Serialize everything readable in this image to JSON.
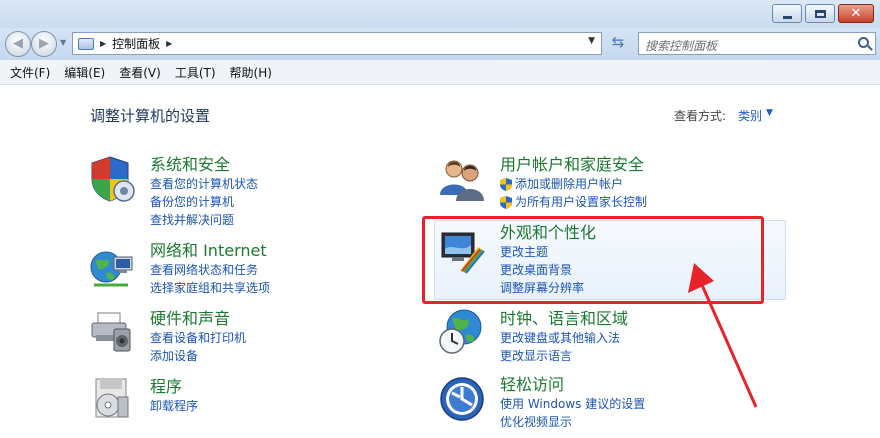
{
  "addressbar": {
    "breadcrumb": "控制面板",
    "search_placeholder": "搜索控制面板"
  },
  "menubar": {
    "items": [
      "文件(F)",
      "编辑(E)",
      "查看(V)",
      "工具(T)",
      "帮助(H)"
    ]
  },
  "main": {
    "title": "调整计算机的设置",
    "view_by_label": "查看方式:",
    "view_by_value": "类别",
    "categories": [
      {
        "title": "系统和安全",
        "links": [
          "查看您的计算机状态",
          "备份您的计算机",
          "查找并解决问题"
        ]
      },
      {
        "title": "网络和 Internet",
        "links": [
          "查看网络状态和任务",
          "选择家庭组和共享选项"
        ]
      },
      {
        "title": "硬件和声音",
        "links": [
          "查看设备和打印机",
          "添加设备"
        ]
      },
      {
        "title": "程序",
        "links": [
          "卸载程序"
        ]
      },
      {
        "title": "用户帐户和家庭安全",
        "links": [
          "添加或删除用户帐户",
          "为所有用户设置家长控制"
        ]
      },
      {
        "title": "外观和个性化",
        "links": [
          "更改主题",
          "更改桌面背景",
          "调整屏幕分辨率"
        ]
      },
      {
        "title": "时钟、语言和区域",
        "links": [
          "更改键盘或其他输入法",
          "更改显示语言"
        ]
      },
      {
        "title": "轻松访问",
        "links": [
          "使用 Windows 建议的设置",
          "优化视频显示"
        ]
      }
    ]
  },
  "colors": {
    "category_title": "#1a7a30",
    "link": "#1c55b3",
    "annotation_red": "#e8242a"
  }
}
